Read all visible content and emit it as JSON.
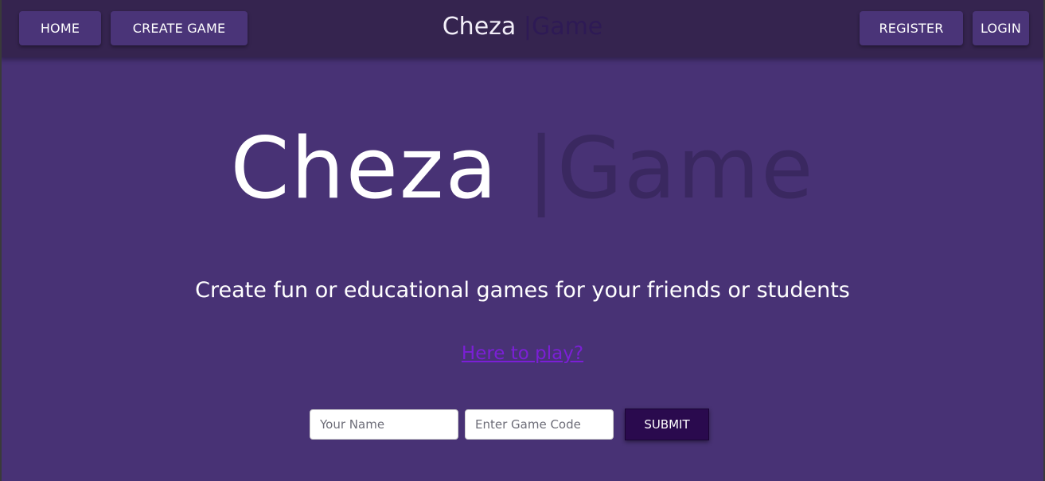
{
  "navbar": {
    "home_label": "HOME",
    "create_label": "CREATE GAME",
    "register_label": "REGISTER",
    "login_label": "LOGIN",
    "brand": {
      "part1": "Cheza",
      "part2": "|Game"
    }
  },
  "hero": {
    "part1": "Cheza",
    "part2": "|Game"
  },
  "tagline": "Create fun or educational games for your friends or students",
  "play_link": "Here to play?",
  "join_form": {
    "name_placeholder": "Your Name",
    "code_placeholder": "Enter Game Code",
    "submit_label": "SUBMIT"
  },
  "colors": {
    "background": "#483275",
    "navbar": "#35244f",
    "nav_button": "#4a3478",
    "submit_button": "#2a0a4e",
    "link": "#7b1fd6"
  }
}
